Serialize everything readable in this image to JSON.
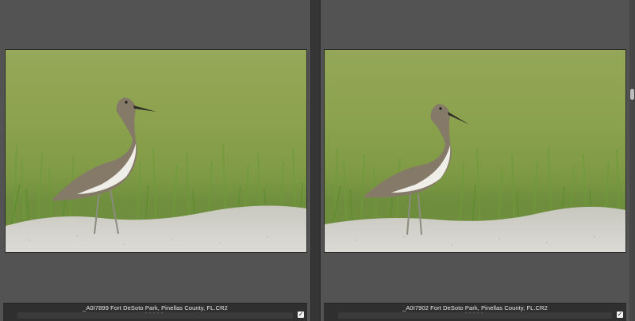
{
  "panes": [
    {
      "filename": "_A0I7899 Fort DeSoto Park, Pinellas County, FL.CR2",
      "rating": 0,
      "max_rating": 5,
      "flagged": true
    },
    {
      "filename": "_A0I7902 Fort DeSoto Park, Pinellas County, FL.CR2",
      "rating": 0,
      "max_rating": 5,
      "flagged": true
    }
  ],
  "icons": {
    "star": "•",
    "check": "✓"
  },
  "colors": {
    "panel": "#535353",
    "divider": "#353535",
    "info_bar": "#2f2f2f",
    "grass": "#8fa74e",
    "sand": "#d4d3cd"
  }
}
